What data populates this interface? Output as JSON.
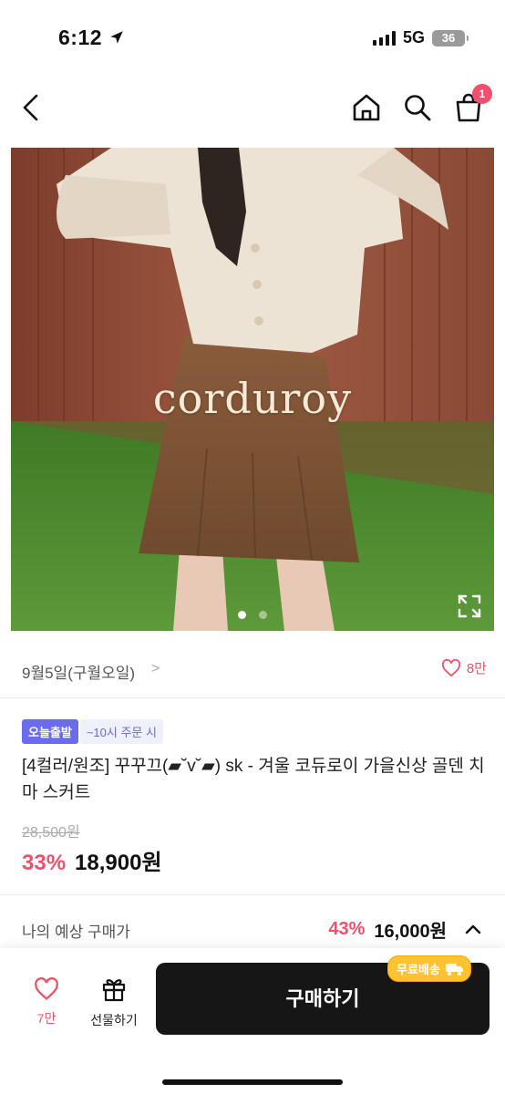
{
  "status": {
    "time": "6:12",
    "network": "5G",
    "battery": "36"
  },
  "nav": {
    "cart_badge": "1"
  },
  "hero": {
    "overlay_text": "corduroy",
    "slide_count": 2,
    "active_slide": 1
  },
  "meta": {
    "date_text": "9월5일(구월오일)",
    "chevron": ">",
    "likes": "8만"
  },
  "tags": {
    "today_ship": "오늘출발",
    "deadline": "~10시 주문 시"
  },
  "product": {
    "title": "[4컬러/원조] 꾸꾸끄(▰˘v˘▰) sk - 겨울 코듀로이 가을신상 골덴 치마 스커트",
    "original_price": "28,500원",
    "discount": "33%",
    "price": "18,900원"
  },
  "estimate": {
    "label": "나의 예상 구매가",
    "discount": "43%",
    "price": "16,000원"
  },
  "bottom": {
    "like_count": "7만",
    "gift_label": "선물하기",
    "buy_label": "구매하기",
    "free_shipping": "무료배송"
  },
  "colors": {
    "accent_pink": "#f0506e",
    "tag_purple": "#6b6bf0",
    "buy_button": "#161616",
    "free_ship": "#ffc233"
  }
}
